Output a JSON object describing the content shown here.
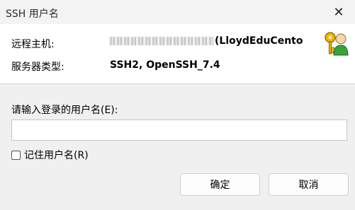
{
  "window": {
    "title": "SSH 用户名",
    "close_symbol": "✕"
  },
  "host": {
    "label": "远程主机:",
    "value_suffix": "(LloydEduCento",
    "icon": "user-key-icon"
  },
  "server_type": {
    "label": "服务器类型:",
    "value": "SSH2, OpenSSH_7.4"
  },
  "prompt": {
    "label": "请输入登录的用户名(E):"
  },
  "username_input": {
    "value": "",
    "placeholder": ""
  },
  "remember": {
    "label": "记住用户名(R)",
    "checked": false
  },
  "buttons": {
    "ok": "确定",
    "cancel": "取消"
  },
  "colors": {
    "panel_bg": "#ffffff",
    "dialog_bg": "#f0f0f0",
    "icon_accent": "#f2b400",
    "icon_green": "#3aa23a"
  }
}
